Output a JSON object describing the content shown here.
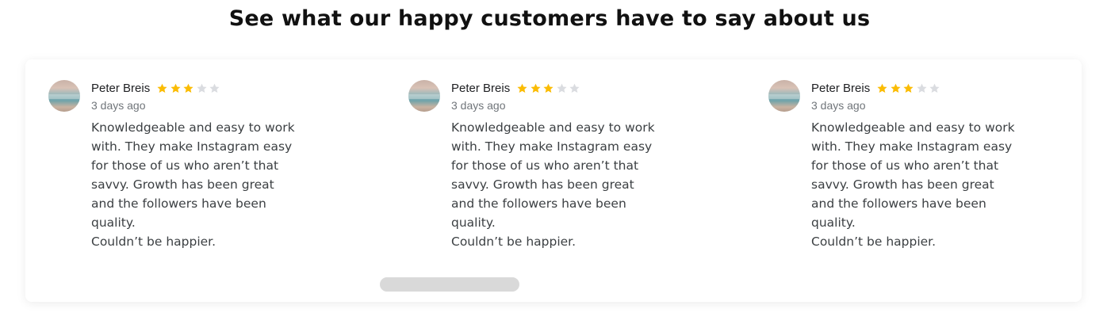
{
  "page": {
    "heading": "See what our happy customers have to say about us"
  },
  "reviews": [
    {
      "name": "Peter Breis",
      "rating": 3,
      "rating_max": 5,
      "time": "3 days ago",
      "text": "Knowledgeable and easy to work\nwith. They make Instagram easy\nfor those of us who aren’t that\nsavvy. Growth has been great\nand the followers have been\nquality.\nCouldn’t be happier."
    },
    {
      "name": "Peter Breis",
      "rating": 3,
      "rating_max": 5,
      "time": "3 days ago",
      "text": "Knowledgeable and easy to work\nwith. They make Instagram easy\nfor those of us who aren’t that\nsavvy. Growth has been great\nand the followers have been\nquality.\nCouldn’t be happier."
    },
    {
      "name": "Peter Breis",
      "rating": 3,
      "rating_max": 5,
      "time": "3 days ago",
      "text": "Knowledgeable and easy to work\nwith. They make Instagram easy\nfor those of us who aren’t that\nsavvy. Growth has been great\nand the followers have been\nquality.\nCouldn’t be happier."
    }
  ],
  "icons": {
    "star": "star-icon",
    "avatar": "avatar"
  },
  "colors": {
    "star_filled": "#fbbc04",
    "star_empty": "#dadce0",
    "scrollbar": "#d9d9d9"
  }
}
